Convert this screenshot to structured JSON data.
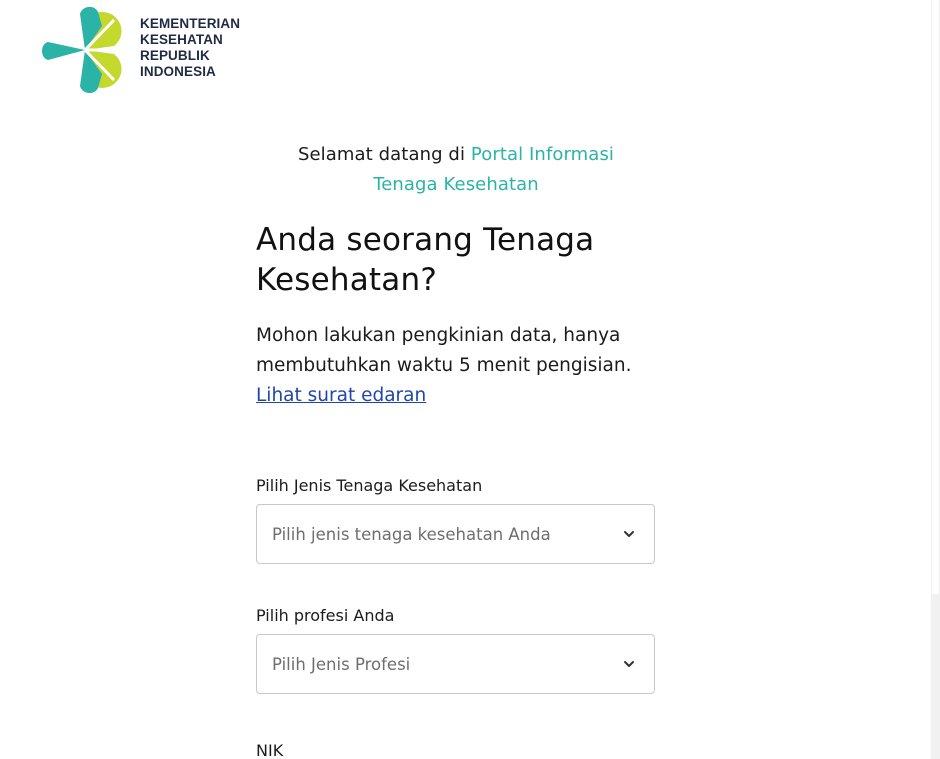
{
  "logo": {
    "lines": [
      "KEMENTERIAN",
      "KESEHATAN",
      "REPUBLIK",
      "INDONESIA"
    ],
    "colors": {
      "teal": "#2ab3a6",
      "lime": "#c4d82e",
      "text": "#1f2a44"
    }
  },
  "welcome": {
    "prefix": "Selamat datang di",
    "accent_line1": "Portal Informasi",
    "accent_line2": "Tenaga Kesehatan"
  },
  "headline": "Anda seorang Tenaga Kesehatan?",
  "description": {
    "text": "Mohon lakukan pengkinian data, hanya membutuhkan waktu 5 menit pengisian.",
    "link": "Lihat surat edaran"
  },
  "form": {
    "jenis_label": "Pilih Jenis Tenaga Kesehatan",
    "jenis_placeholder": "Pilih jenis tenaga kesehatan Anda",
    "profesi_label": "Pilih profesi Anda",
    "profesi_placeholder": "Pilih Jenis Profesi",
    "nik_label": "NIK"
  },
  "colors": {
    "accent": "#2ab3a6",
    "link": "#2246a8",
    "border": "#c8c8c8"
  },
  "icons": [
    "kemenkes-logo-icon",
    "chevron-down-icon"
  ]
}
